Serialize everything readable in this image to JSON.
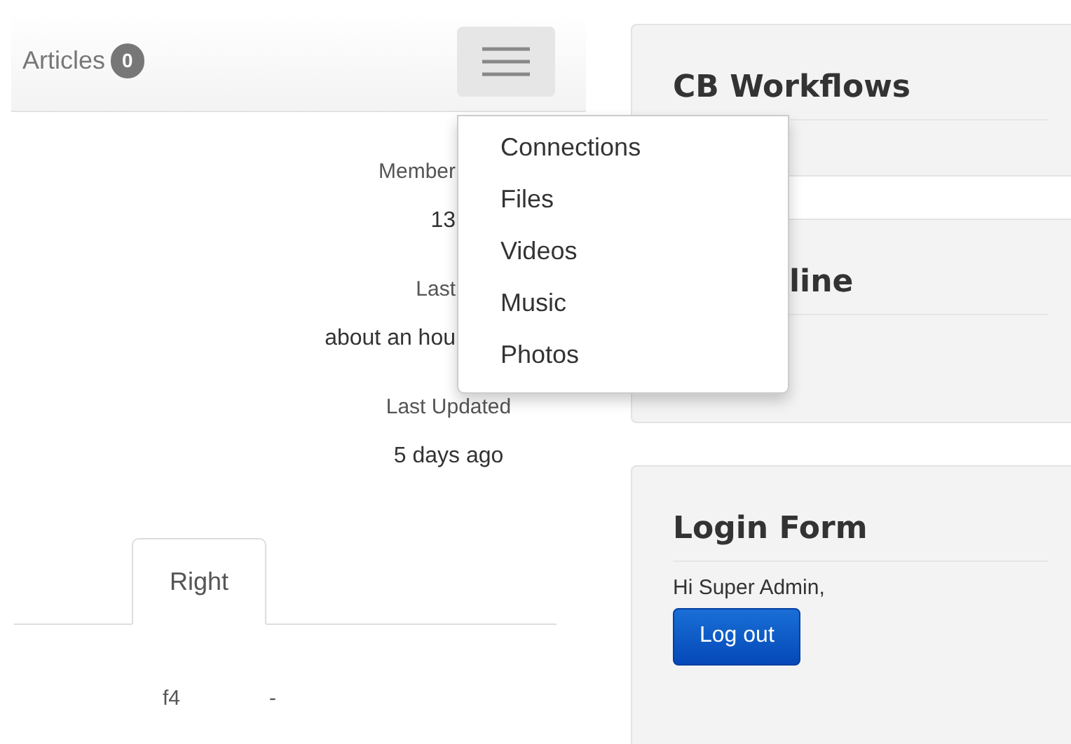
{
  "navbar": {
    "label": "Articles",
    "badge": "0"
  },
  "menu": {
    "expanded": true,
    "items": [
      "Connections",
      "Files",
      "Videos",
      "Music",
      "Photos"
    ]
  },
  "stats": [
    {
      "kind": "covered",
      "label": "Member",
      "value": "13"
    },
    {
      "kind": "covered",
      "label": "Last",
      "value": "about an hou"
    },
    {
      "kind": "full",
      "label": "Last Updated",
      "value": "5 days ago"
    }
  ],
  "tabs": [
    {
      "label": "Right",
      "selected": true
    }
  ],
  "fields": [
    {
      "name": "f4",
      "value": "-"
    }
  ],
  "modules": [
    {
      "kind": "plain",
      "title": "CB Workflows"
    },
    {
      "kind": "covered",
      "title": "line"
    },
    {
      "kind": "login",
      "title": "Login Form",
      "greeting": "Hi Super Admin,",
      "button": "Log out"
    }
  ]
}
